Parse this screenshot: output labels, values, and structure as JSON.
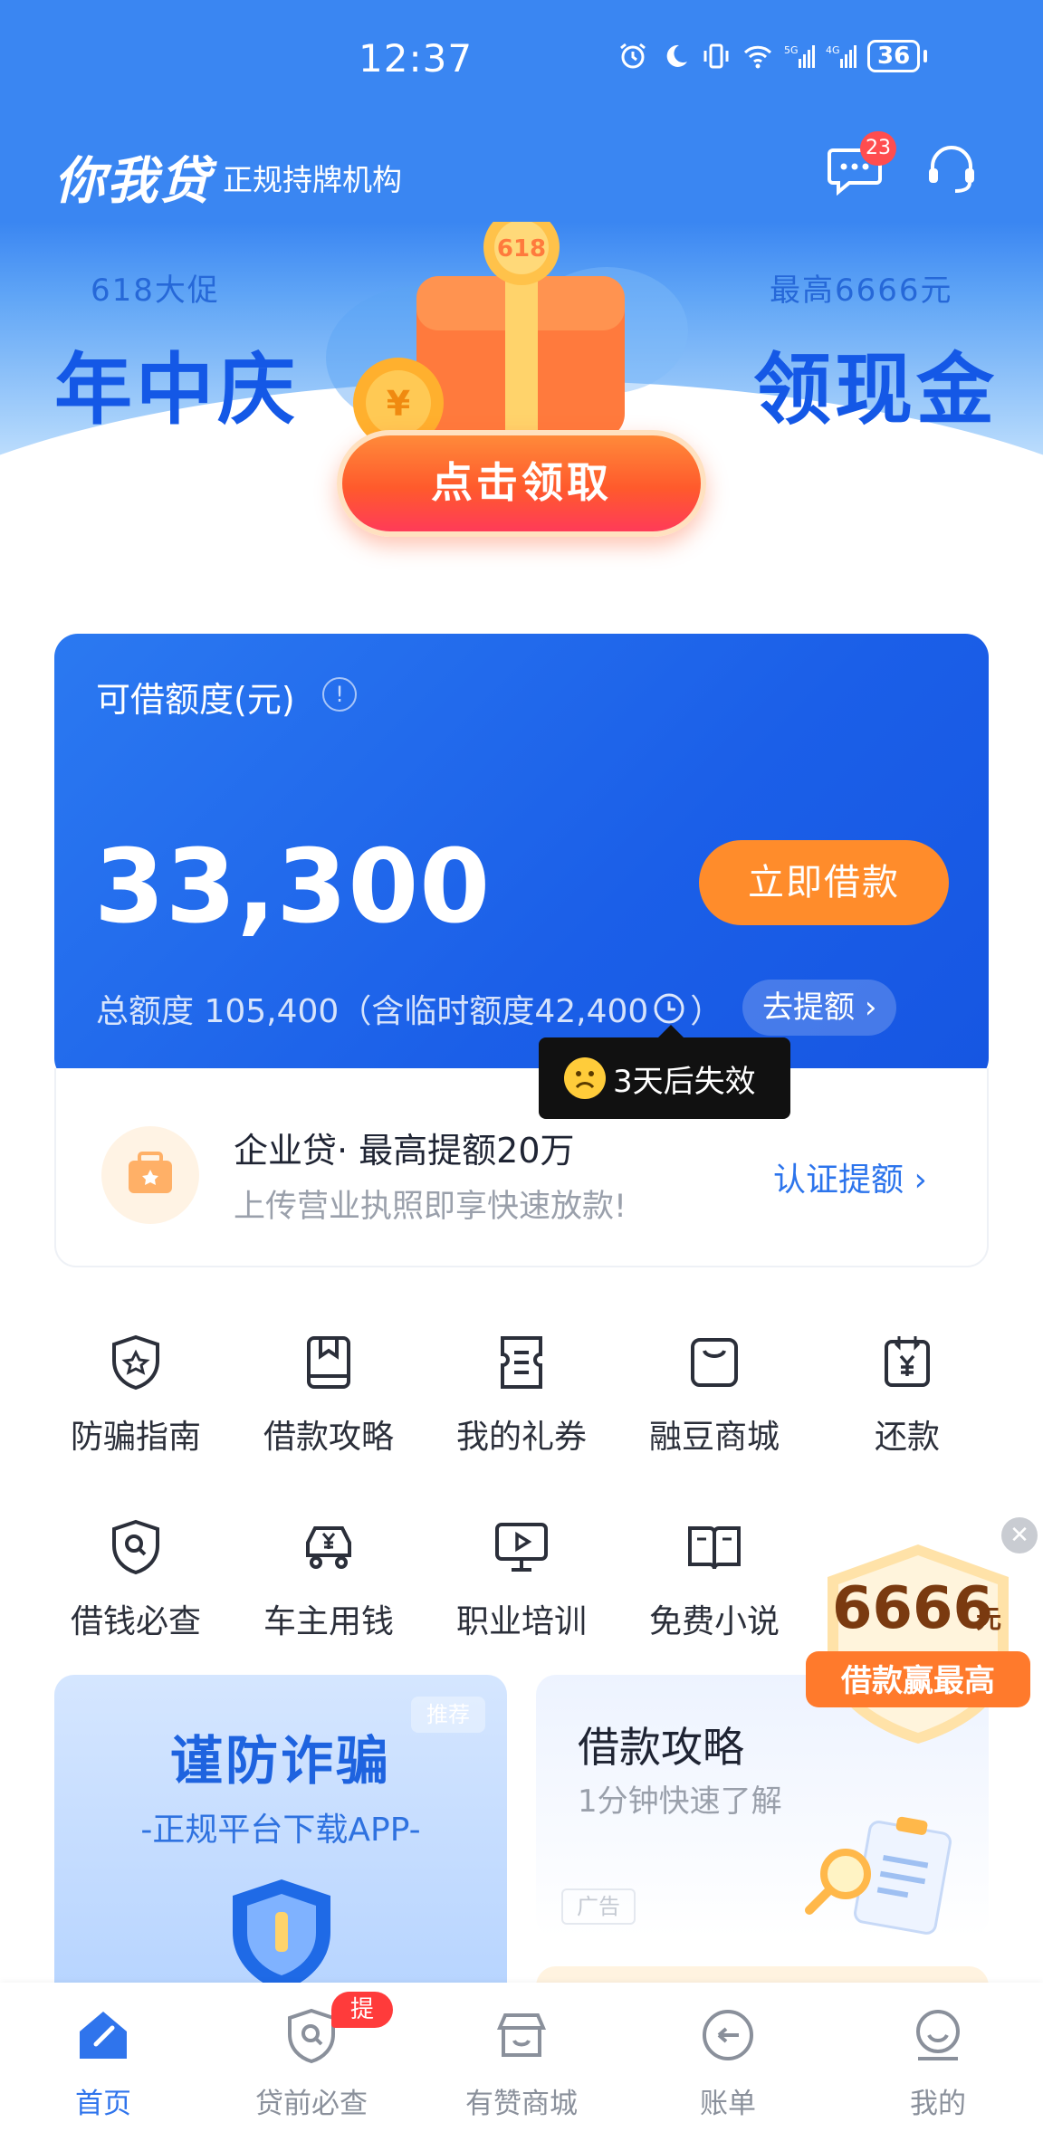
{
  "status_bar": {
    "time": "12:37",
    "battery": "36"
  },
  "header": {
    "brand": "你我贷",
    "subtitle": "正规持牌机构",
    "message_count": "23"
  },
  "banner": {
    "left_small": "618大促",
    "left_big": "年中庆",
    "right_small": "最高6666元",
    "right_big": "领现金",
    "gift_label": "618",
    "claim_button": "点击领取"
  },
  "credit": {
    "label": "可借额度(元)",
    "amount": "33,300",
    "borrow_button": "立即借款",
    "total_prefix": "总额度 105,400（含临时额度42,400",
    "total_suffix": "）",
    "raise_button": "去提额",
    "tooltip": "3天后失效"
  },
  "enterprise": {
    "title": "企业贷· 最高提额20万",
    "subtitle": "上传营业执照即享快速放款!",
    "link": "认证提额"
  },
  "menu": [
    {
      "label": "防骗指南",
      "icon": "shield-star-icon"
    },
    {
      "label": "借款攻略",
      "icon": "bookmark-book-icon"
    },
    {
      "label": "我的礼券",
      "icon": "coupon-icon"
    },
    {
      "label": "融豆商城",
      "icon": "shopping-bag-icon"
    },
    {
      "label": "还款",
      "icon": "repay-yen-icon"
    },
    {
      "label": "借钱必查",
      "icon": "shield-search-icon"
    },
    {
      "label": "车主用钱",
      "icon": "car-yen-icon"
    },
    {
      "label": "职业培训",
      "icon": "video-training-icon"
    },
    {
      "label": "免费小说",
      "icon": "open-book-icon"
    }
  ],
  "promo": {
    "amount": "6666",
    "unit": "元",
    "caption": "借款赢最高"
  },
  "cards": {
    "left_title": "谨防诈骗",
    "left_subtitle": "-正规平台下载APP-",
    "left_tag": "推荐",
    "right_title": "借款攻略",
    "right_subtitle": "1分钟快速了解",
    "right_tag": "广告"
  },
  "nav": [
    {
      "label": "首页",
      "active": true
    },
    {
      "label": "贷前必查",
      "badge": "提额"
    },
    {
      "label": "有赞商城"
    },
    {
      "label": "账单"
    },
    {
      "label": "我的"
    }
  ],
  "colors": {
    "primary": "#2f74ec",
    "accent": "#ff8c2b",
    "badge": "#ff4d4f"
  }
}
